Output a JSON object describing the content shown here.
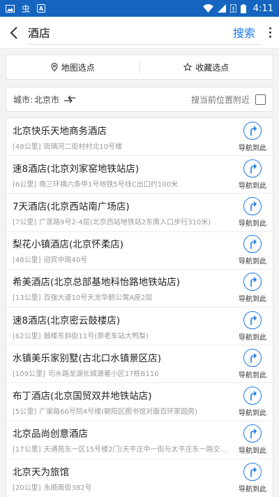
{
  "status_bar": {
    "time": "4:11",
    "icons": [
      "image-icon",
      "app-icon",
      "a-box-icon",
      "wifi-icon",
      "signal-icon",
      "no-sim-icon",
      "battery-icon"
    ],
    "left_glyph": "虫",
    "a_glyph": "A"
  },
  "search": {
    "query": "酒店",
    "button_label": "搜索"
  },
  "pick": {
    "map_label": "地图选点",
    "fav_label": "收藏选点"
  },
  "city": {
    "label": "城市:",
    "value": "北京市",
    "nearby_label": "搜当前位置附近"
  },
  "colors": {
    "brand": "#1565c0",
    "accent": "#1e7ae8"
  },
  "results": [
    {
      "name": "北京快乐天地商务酒店",
      "distance": "[48公里]",
      "address": "琉璃河二街村村北10号楼",
      "nav_label": "导航到此"
    },
    {
      "name": "速8酒店(北京刘家窑地铁站店)",
      "distance": "[6公里]",
      "address": "南三环横六条甲1号地铁5号线C出口约100米",
      "nav_label": "导航到此"
    },
    {
      "name": "7天酒店(北京西站南广场店)",
      "distance": "[7公里]",
      "address": "广莲路9号2-4层(北京西站地铁站2东南入口步行310米)",
      "nav_label": "导航到此"
    },
    {
      "name": "梨花小镇酒店(北京怀柔店)",
      "distance": "[48公里]",
      "address": "迎宾中路40号",
      "nav_label": "导航到此"
    },
    {
      "name": "希美酒店(北京总部基地科怡路地铁站店)",
      "distance": "[13公里]",
      "address": "百强大道10号天龙华鹤公寓A座2层",
      "nav_label": "导航到此"
    },
    {
      "name": "速8酒店(北京密云鼓楼店)",
      "distance": "[62公里]",
      "address": "鼓楼东斜街11号(原老车站大鸭梨)",
      "nav_label": "导航到此"
    },
    {
      "name": "水镇美乐家别墅(古北口水镇景区店)",
      "distance": "[109公里]",
      "address": "司水路龙湖长城源著小区17栋B110",
      "nav_label": "导航到此"
    },
    {
      "name": "布丁酒店(北京国贸双井地铁站店)",
      "distance": "[5公里]",
      "address": "广渠路66号院4号楼(朝阳区图书馆对面百环家园旁)",
      "nav_label": "导航到此"
    },
    {
      "name": "北京品尚创意酒店",
      "distance": "[17公里]",
      "address": "天通苑东一区15号楼2门(天平庄中一街与太平庄东一路交...",
      "nav_label": "导航到此"
    },
    {
      "name": "北京天为旅馆",
      "distance": "[20公里]",
      "address": "永顺南街382号",
      "nav_label": "导航到此"
    }
  ]
}
